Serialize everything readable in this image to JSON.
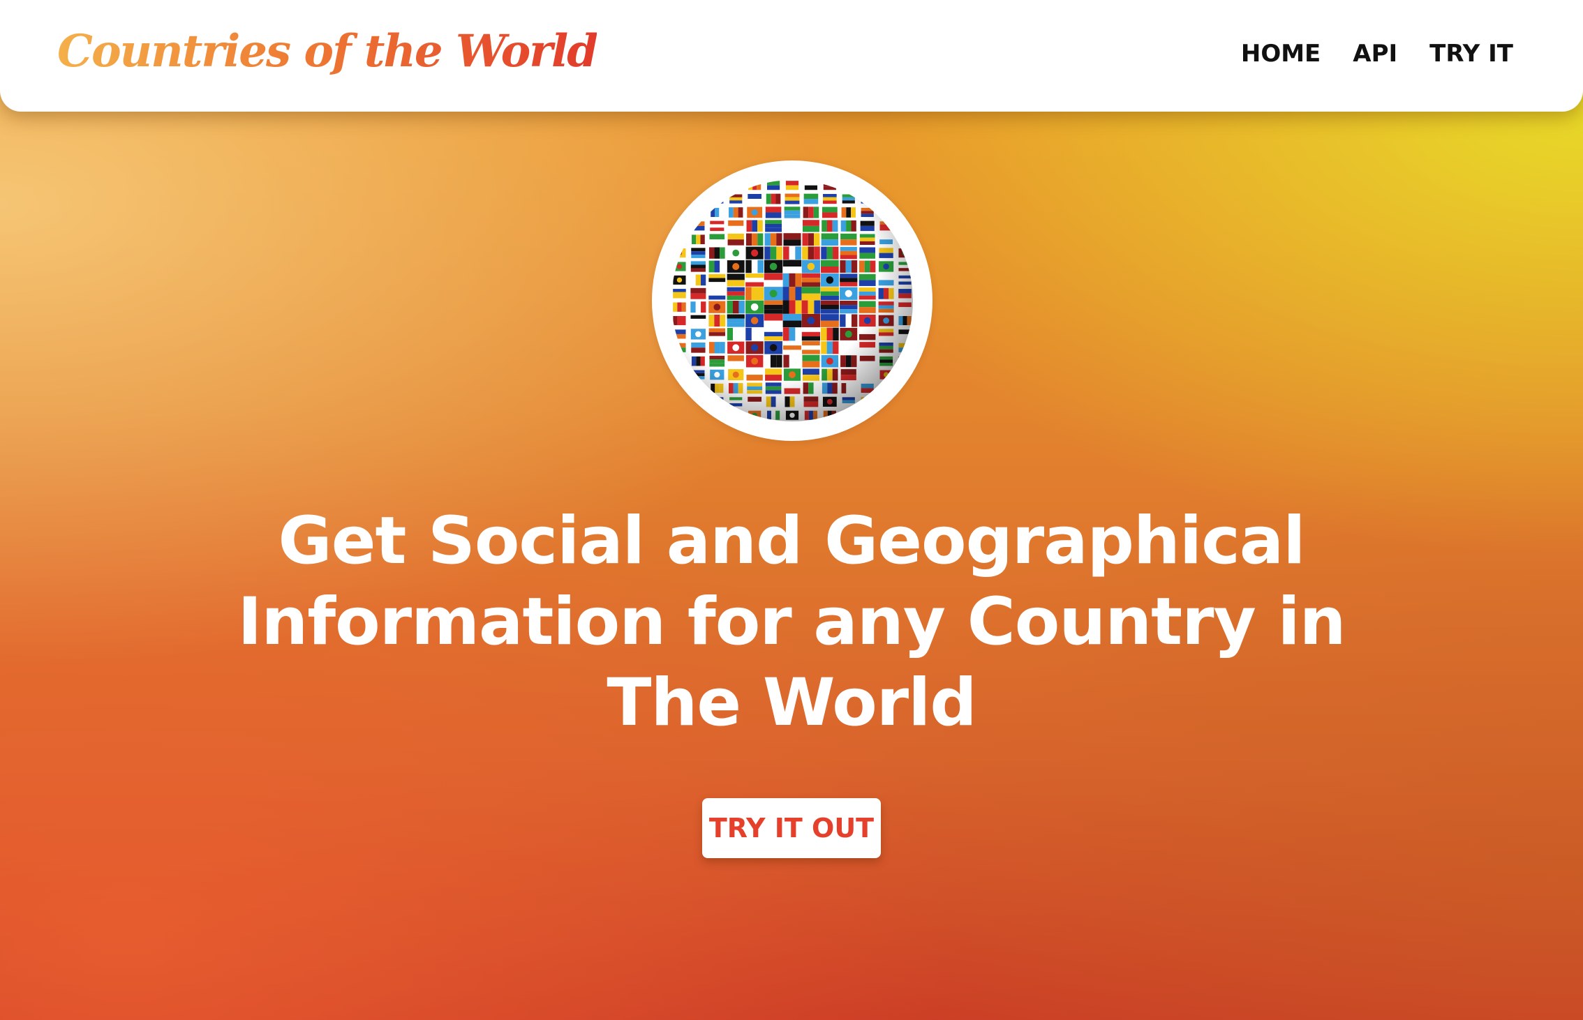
{
  "header": {
    "brand": "Countries of the World",
    "nav": [
      {
        "label": "HOME"
      },
      {
        "label": "API"
      },
      {
        "label": "TRY IT"
      }
    ]
  },
  "hero": {
    "logo_icon": "flag-globe-icon",
    "title": "Get Social and Geographical Information for any Country in The World",
    "cta_label": "TRY IT OUT"
  },
  "colors": {
    "brand_gradient_start": "#f4b04a",
    "brand_gradient_end": "#e23b2b",
    "background_top_right": "#e8de28",
    "background_bottom": "#cc3d26",
    "cta_text": "#e5402c",
    "nav_text": "#111111"
  }
}
